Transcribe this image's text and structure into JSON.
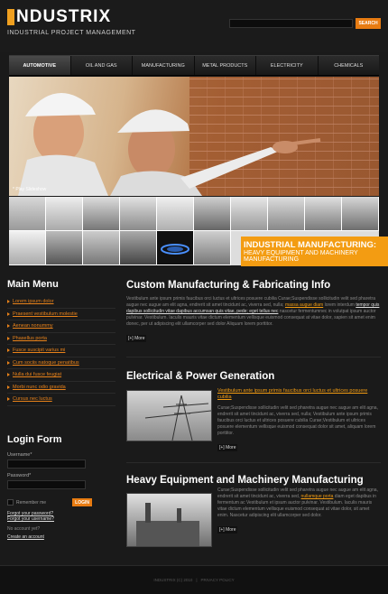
{
  "brand": {
    "name": "NDUSTRIX",
    "tagline": "INDUSTRIAL PROJECT MANAGEMENT"
  },
  "search": {
    "button_label": "SEARCH",
    "placeholder": ""
  },
  "nav": {
    "items": [
      {
        "label": "AUTOMOTIVE",
        "active": true
      },
      {
        "label": "OIL AND GAS",
        "active": false
      },
      {
        "label": "MANUFACTURING",
        "active": false
      },
      {
        "label": "METAL PRODUCTS",
        "active": false
      },
      {
        "label": "ELECTRICITY",
        "active": false
      },
      {
        "label": "CHEMICALS",
        "active": false
      }
    ]
  },
  "hero": {
    "caption": "* Play Slideshow"
  },
  "promo": {
    "title": "INDUSTRIAL MANUFACTURING:",
    "line1": "HEAVY EQUIPMENT AND MACHINERY",
    "line2": "MANUFACTURING"
  },
  "sidebar": {
    "menu_title": "Main Menu",
    "items": [
      {
        "label": "Lorem ipsum dolor"
      },
      {
        "label": "Praesent vestibulum molestie"
      },
      {
        "label": "Aenean nonummy"
      },
      {
        "label": "Phasellus porta"
      },
      {
        "label": "Fusce suscipit varius mi"
      },
      {
        "label": "Cum sociis natoque penatibus"
      },
      {
        "label": "Nulla dui fusce feugiat"
      },
      {
        "label": "Morbi nunc odio gravida"
      },
      {
        "label": "Cursus nec luctus"
      }
    ]
  },
  "login": {
    "title": "Login Form",
    "username_label": "Username*",
    "password_label": "Password*",
    "remember_label": "Remember me",
    "button_label": "LOGIN",
    "forgot_password": "Forgot your password?",
    "forgot_username": "Forgot your username?",
    "no_account": "No account yet?",
    "create_account": "Create an account"
  },
  "articles": [
    {
      "title": "Custom Manufacturing & Fabricating Info",
      "body1": "Vestibulum ante ipsum primis faucibus orci luctus et ultrices posuere cubilia Curae;Suspendisse sollicitudin velit sed pharetra augue nec augue am elit agna, endrerit sit amet tincidunt ac, viverra sed, nulla; ",
      "highlight": "massa augue diam",
      "body2": " lorem interdum ",
      "white_link": "tempor quis dapibus sollicitudin vitae dapibus accumsan quis vitae, pede; eget tellus nec",
      "body3": " nascetur fermentumnec in volutpat ipsum auctor pulvinar. Vestibulum. Iaculis mauris vitae dictum elementum vellisque euismod consequat at vitae dolor, sapien sit amet enim donec, per ut adipiscing elit ullamcorper sed dolor Aliquam lorem porttitor.",
      "more": "[+] More"
    },
    {
      "title": "Electrical & Power Generation",
      "link": "Vestibulum ante ipsum primis faucibus orci luctus et ultrices posuere cubilia",
      "body": "Curae;Suspendisse sollicitudin velit sed pharetra augue nec augue am elit agna, endrerit sit amet tincidunt ac, viverra sed, nulla; Vestibulum ante ipsum primis faucibus orci luctus et ultrices posuere cubilia Curae;Vestibulum et ultrices posuere elementum vellisque euismod consequat dolor sit amet, aliquam lorem porttitor.",
      "more": "[+] More"
    },
    {
      "title": "Heavy Equipment and Machinery Manufacturing",
      "body1": "Curae;Suspendisse sollicitudin velit sed pharetra augue nec augue am elit agna, endrerit sit amet tincidunt ac, viverra sed, ",
      "highlight": "nullamque porta",
      "body2": " diam eget dapibus in fermentum ac Vestibulum et ipsum auctor pulvinar. Vestibulum. Iaculis mauris vitae dictum elementum vellisque euismod consequat at vitae dolor, sit amet enim. Nascetur adipiscing elit ullamcorper sed dolor.",
      "more": "[+] More"
    }
  ],
  "footer": {
    "copyright": "INDUSTRIX (C) 2010",
    "divider": "|",
    "privacy": "PRIVACY POLICY"
  }
}
